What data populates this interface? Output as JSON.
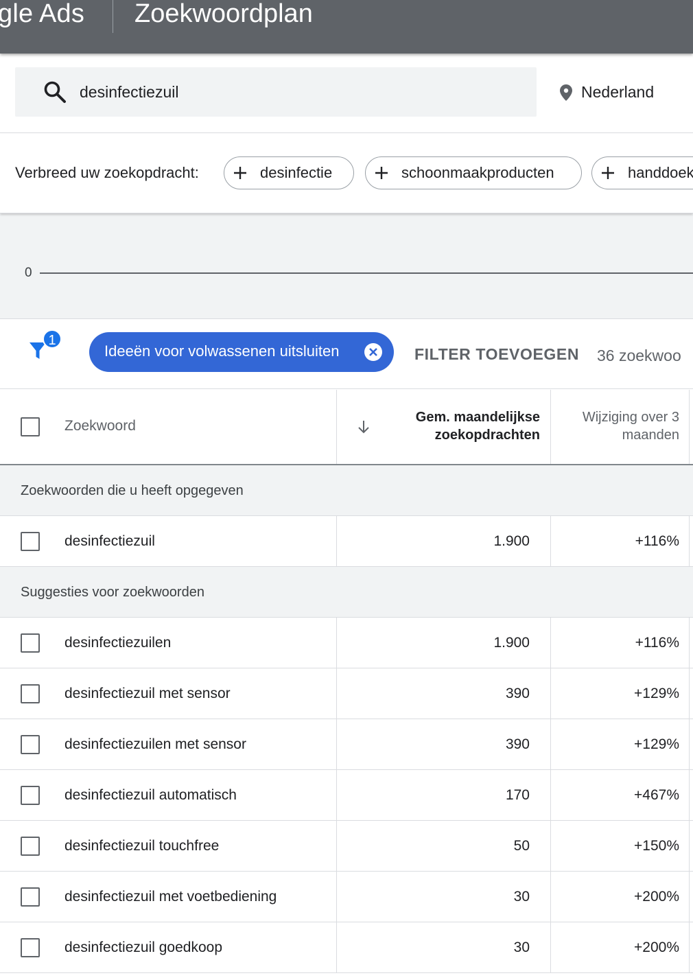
{
  "app": {
    "brand": "gle Ads",
    "page_title": "Zoekwoordplan"
  },
  "search": {
    "query": "desinfectiezuil",
    "location": "Nederland"
  },
  "broaden": {
    "label": "Verbreed uw zoekopdracht:",
    "chips": [
      "desinfectie",
      "schoonmaakproducten",
      "handdoek"
    ]
  },
  "graph": {
    "zero_label": "0"
  },
  "filters": {
    "badge_count": "1",
    "active_filter": "Ideeën voor volwassenen uitsluiten",
    "add_filter": "FILTER TOEVOEGEN",
    "result_count": "36 zoekwoo"
  },
  "table": {
    "headers": {
      "keyword": "Zoekwoord",
      "monthly_line1": "Gem. maandelijkse",
      "monthly_line2": "zoekopdrachten",
      "change_line1": "Wijziging over 3",
      "change_line2": "maanden"
    },
    "section_provided": "Zoekwoorden die u heeft opgegeven",
    "provided_rows": [
      {
        "keyword": "desinfectiezuil",
        "monthly": "1.900",
        "change": "+116%"
      }
    ],
    "section_suggestions": "Suggesties voor zoekwoorden",
    "suggestion_rows": [
      {
        "keyword": "desinfectiezuilen",
        "monthly": "1.900",
        "change": "+116%"
      },
      {
        "keyword": "desinfectiezuil met sensor",
        "monthly": "390",
        "change": "+129%"
      },
      {
        "keyword": "desinfectiezuilen met sensor",
        "monthly": "390",
        "change": "+129%"
      },
      {
        "keyword": "desinfectiezuil automatisch",
        "monthly": "170",
        "change": "+467%"
      },
      {
        "keyword": "desinfectiezuil touchfree",
        "monthly": "50",
        "change": "+150%"
      },
      {
        "keyword": "desinfectiezuil met voetbediening",
        "monthly": "30",
        "change": "+200%"
      },
      {
        "keyword": "desinfectiezuil goedkoop",
        "monthly": "30",
        "change": "+200%"
      }
    ]
  },
  "colors": {
    "appbar": "#5f6368",
    "accent": "#1a73e8",
    "pill": "#3367d6"
  }
}
